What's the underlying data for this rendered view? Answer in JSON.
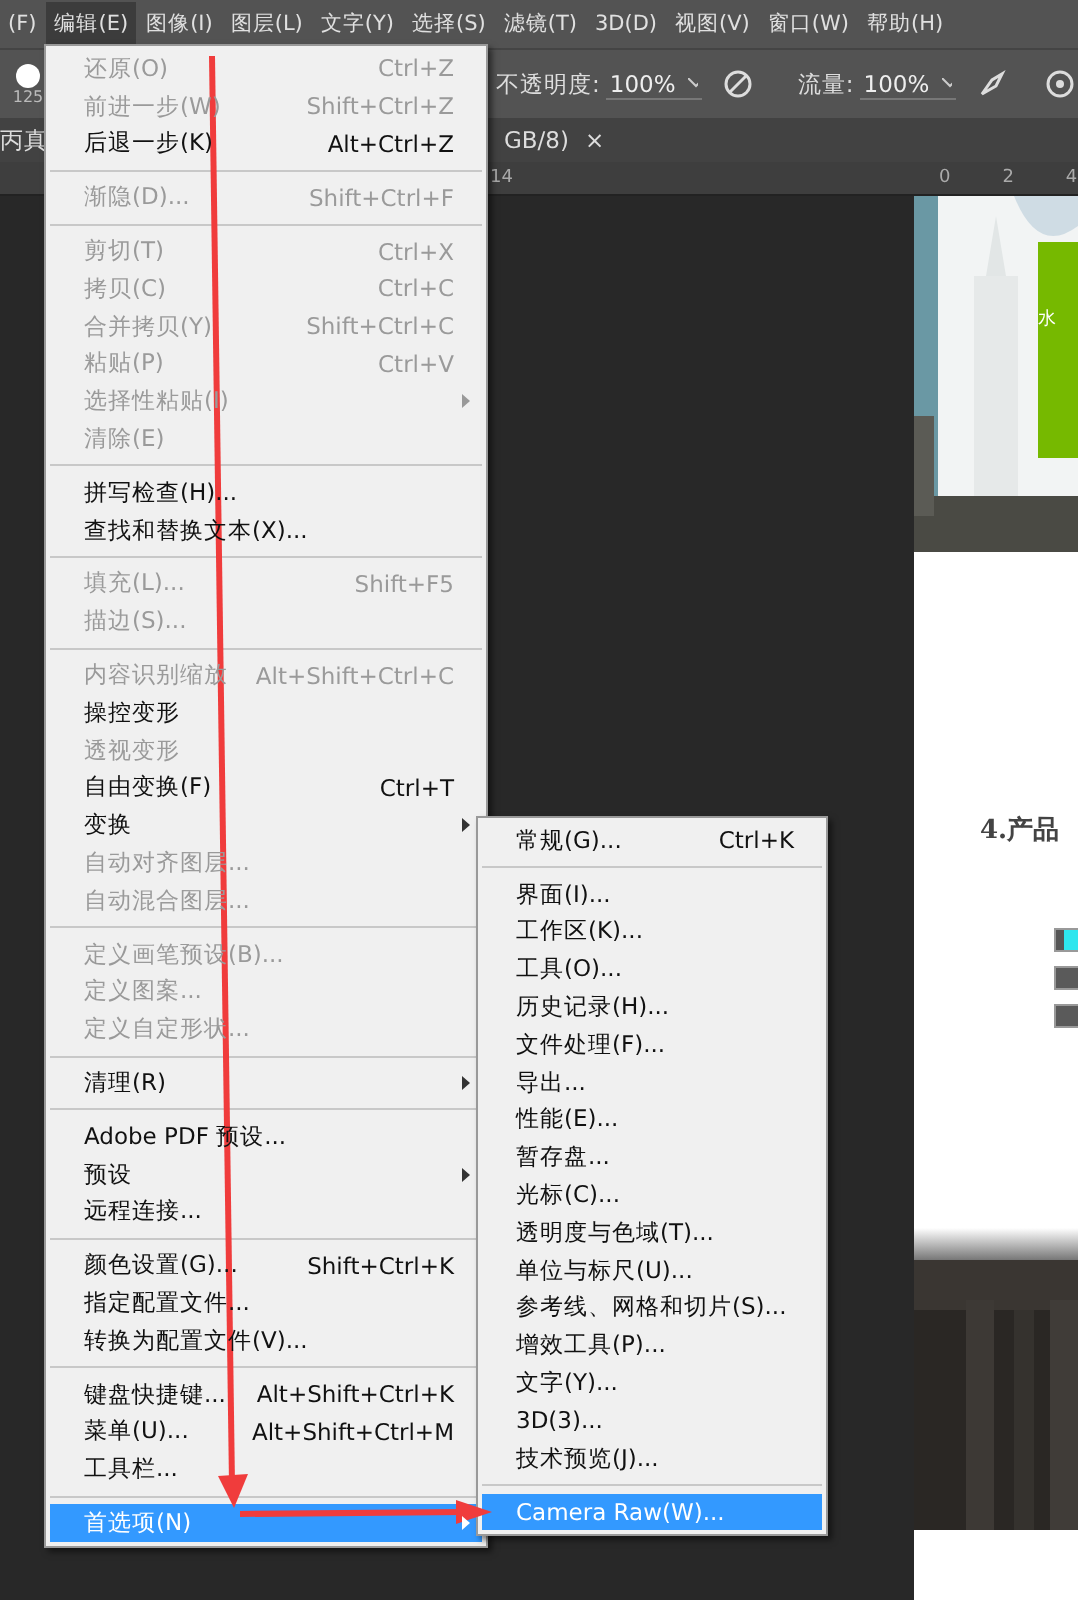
{
  "menu_bar": [
    {
      "label": "(F)",
      "selected": false
    },
    {
      "label": "编辑(E)",
      "selected": true
    },
    {
      "label": "图像(I)",
      "selected": false
    },
    {
      "label": "图层(L)",
      "selected": false
    },
    {
      "label": "文字(Y)",
      "selected": false
    },
    {
      "label": "选择(S)",
      "selected": false
    },
    {
      "label": "滤镜(T)",
      "selected": false
    },
    {
      "label": "3D(D)",
      "selected": false
    },
    {
      "label": "视图(V)",
      "selected": false
    },
    {
      "label": "窗口(W)",
      "selected": false
    },
    {
      "label": "帮助(H)",
      "selected": false
    }
  ],
  "options_bar": {
    "brush_size": "125",
    "opacity_label": "不透明度:",
    "opacity": "100%",
    "flow_label": "流量:",
    "flow": "100%"
  },
  "document_tab": {
    "title_start": "丙真",
    "title_end": "GB/8)",
    "close": "×"
  },
  "ruler": [
    "14",
    "0",
    "2",
    "4"
  ],
  "edit_menu": {
    "items": [
      {
        "kind": "item",
        "label": "还原(O)",
        "shortcut": "Ctrl+Z",
        "disabled": true
      },
      {
        "kind": "item",
        "label": "前进一步(W)",
        "shortcut": "Shift+Ctrl+Z",
        "disabled": true
      },
      {
        "kind": "item",
        "label": "后退一步(K)",
        "shortcut": "Alt+Ctrl+Z",
        "disabled": false
      },
      {
        "kind": "separator"
      },
      {
        "kind": "item",
        "label": "渐隐(D)...",
        "shortcut": "Shift+Ctrl+F",
        "disabled": true
      },
      {
        "kind": "separator"
      },
      {
        "kind": "item",
        "label": "剪切(T)",
        "shortcut": "Ctrl+X",
        "disabled": true
      },
      {
        "kind": "item",
        "label": "拷贝(C)",
        "shortcut": "Ctrl+C",
        "disabled": true
      },
      {
        "kind": "item",
        "label": "合并拷贝(Y)",
        "shortcut": "Shift+Ctrl+C",
        "disabled": true
      },
      {
        "kind": "item",
        "label": "粘贴(P)",
        "shortcut": "Ctrl+V",
        "disabled": true
      },
      {
        "kind": "item",
        "label": "选择性粘贴(I)",
        "disabled": true,
        "submenu": true
      },
      {
        "kind": "item",
        "label": "清除(E)",
        "disabled": true
      },
      {
        "kind": "separator"
      },
      {
        "kind": "item",
        "label": "拼写检查(H)...",
        "disabled": false
      },
      {
        "kind": "item",
        "label": "查找和替换文本(X)...",
        "disabled": false
      },
      {
        "kind": "separator"
      },
      {
        "kind": "item",
        "label": "填充(L)...",
        "shortcut": "Shift+F5",
        "disabled": true
      },
      {
        "kind": "item",
        "label": "描边(S)...",
        "disabled": true
      },
      {
        "kind": "separator"
      },
      {
        "kind": "item",
        "label": "内容识别缩放",
        "shortcut": "Alt+Shift+Ctrl+C",
        "disabled": true
      },
      {
        "kind": "item",
        "label": "操控变形",
        "disabled": false
      },
      {
        "kind": "item",
        "label": "透视变形",
        "disabled": true
      },
      {
        "kind": "item",
        "label": "自由变换(F)",
        "shortcut": "Ctrl+T",
        "disabled": false
      },
      {
        "kind": "item",
        "label": "变换",
        "disabled": false,
        "submenu": true
      },
      {
        "kind": "item",
        "label": "自动对齐图层...",
        "disabled": true
      },
      {
        "kind": "item",
        "label": "自动混合图层...",
        "disabled": true
      },
      {
        "kind": "separator"
      },
      {
        "kind": "item",
        "label": "定义画笔预设(B)...",
        "disabled": true
      },
      {
        "kind": "item",
        "label": "定义图案...",
        "disabled": true
      },
      {
        "kind": "item",
        "label": "定义自定形状...",
        "disabled": true
      },
      {
        "kind": "separator"
      },
      {
        "kind": "item",
        "label": "清理(R)",
        "disabled": false,
        "submenu": true
      },
      {
        "kind": "separator"
      },
      {
        "kind": "item",
        "label": "Adobe PDF 预设...",
        "disabled": false
      },
      {
        "kind": "item",
        "label": "预设",
        "disabled": false,
        "submenu": true
      },
      {
        "kind": "item",
        "label": "远程连接...",
        "disabled": false
      },
      {
        "kind": "separator"
      },
      {
        "kind": "item",
        "label": "颜色设置(G)...",
        "shortcut": "Shift+Ctrl+K",
        "disabled": false
      },
      {
        "kind": "item",
        "label": "指定配置文件...",
        "disabled": false
      },
      {
        "kind": "item",
        "label": "转换为配置文件(V)...",
        "disabled": false
      },
      {
        "kind": "separator"
      },
      {
        "kind": "item",
        "label": "键盘快捷键...",
        "shortcut": "Alt+Shift+Ctrl+K",
        "disabled": false
      },
      {
        "kind": "item",
        "label": "菜单(U)...",
        "shortcut": "Alt+Shift+Ctrl+M",
        "disabled": false
      },
      {
        "kind": "item",
        "label": "工具栏...",
        "disabled": false
      },
      {
        "kind": "separator"
      },
      {
        "kind": "item",
        "label": "首选项(N)",
        "disabled": false,
        "submenu": true,
        "selected": true
      }
    ]
  },
  "preferences_menu": {
    "items": [
      {
        "kind": "item",
        "label": "常规(G)...",
        "shortcut": "Ctrl+K",
        "selected": false
      },
      {
        "kind": "separator"
      },
      {
        "kind": "item",
        "label": "界面(I)...",
        "selected": false
      },
      {
        "kind": "item",
        "label": "工作区(K)...",
        "selected": false
      },
      {
        "kind": "item",
        "label": "工具(O)...",
        "selected": false
      },
      {
        "kind": "item",
        "label": "历史记录(H)...",
        "selected": false
      },
      {
        "kind": "item",
        "label": "文件处理(F)...",
        "selected": false
      },
      {
        "kind": "item",
        "label": "导出...",
        "selected": false
      },
      {
        "kind": "item",
        "label": "性能(E)...",
        "selected": false
      },
      {
        "kind": "item",
        "label": "暂存盘...",
        "selected": false
      },
      {
        "kind": "item",
        "label": "光标(C)...",
        "selected": false
      },
      {
        "kind": "item",
        "label": "透明度与色域(T)...",
        "selected": false
      },
      {
        "kind": "item",
        "label": "单位与标尺(U)...",
        "selected": false
      },
      {
        "kind": "item",
        "label": "参考线、网格和切片(S)...",
        "selected": false
      },
      {
        "kind": "item",
        "label": "增效工具(P)...",
        "selected": false
      },
      {
        "kind": "item",
        "label": "文字(Y)...",
        "selected": false
      },
      {
        "kind": "item",
        "label": "3D(3)...",
        "selected": false
      },
      {
        "kind": "item",
        "label": "技术预览(J)...",
        "selected": false
      },
      {
        "kind": "separator"
      },
      {
        "kind": "item",
        "label": "Camera Raw(W)...",
        "selected": true
      }
    ]
  },
  "document": {
    "heading": "4.产品",
    "green_panel_text": "水"
  }
}
